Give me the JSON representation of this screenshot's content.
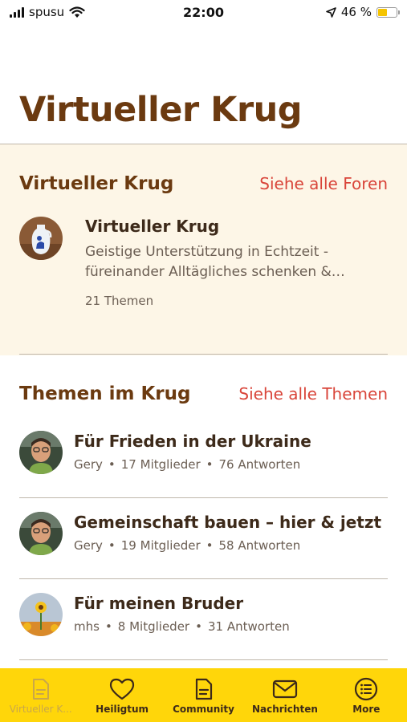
{
  "status_bar": {
    "carrier": "spusu",
    "time": "22:00",
    "battery_text": "46 %",
    "battery_level": 0.46
  },
  "page": {
    "title": "Virtueller Krug"
  },
  "krug_section": {
    "title": "Virtueller Krug",
    "link": "Siehe alle Foren",
    "forum": {
      "name": "Virtueller Krug",
      "description": "Geistige Unterstützung in Echtzeit - füreinander Alltägliches schenken &…",
      "topic_count": "21 Themen"
    }
  },
  "themen_section": {
    "title": "Themen im Krug",
    "link": "Siehe alle Themen",
    "topics": [
      {
        "title": "Für Frieden in der Ukraine",
        "author": "Gery",
        "members": "17 Mitglieder",
        "replies": "76 Antworten"
      },
      {
        "title": "Gemeinschaft bauen – hier & jetzt",
        "author": "Gery",
        "members": "19 Mitglieder",
        "replies": "58 Antworten"
      },
      {
        "title": "Für meinen Bruder",
        "author": "mhs",
        "members": "8 Mitglieder",
        "replies": "31 Antworten"
      }
    ],
    "separator": "•"
  },
  "tab_bar": {
    "tabs": [
      {
        "label": "Virtueller K...",
        "icon": "document-icon",
        "active": true
      },
      {
        "label": "Heiligtum",
        "icon": "heart-icon",
        "active": false
      },
      {
        "label": "Community",
        "icon": "document-lines-icon",
        "active": false
      },
      {
        "label": "Nachrichten",
        "icon": "envelope-icon",
        "active": false
      },
      {
        "label": "More",
        "icon": "list-circle-icon",
        "active": false
      }
    ]
  },
  "colors": {
    "accent_brown": "#6b3a10",
    "link_red": "#d9453a",
    "tab_bar_yellow": "#ffd60a",
    "section_bg": "#fdf6e7"
  }
}
